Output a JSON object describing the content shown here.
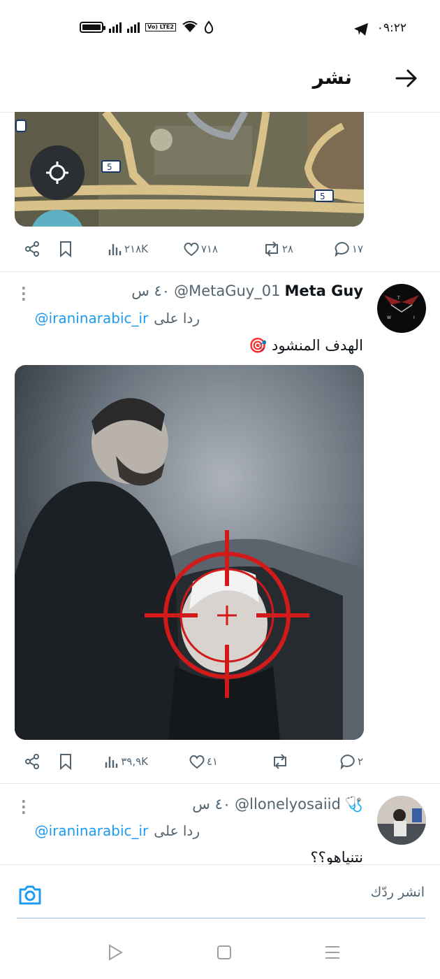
{
  "status_bar": {
    "time": "٠٩:٢٢",
    "network_label": "Vo) LTE2"
  },
  "header": {
    "title": "نشر"
  },
  "tweet1_actions": {
    "replies": "١٧",
    "retweets": "٢٨",
    "likes": "٧١٨",
    "views": "٢١٨K"
  },
  "tweet2": {
    "name": "Meta Guy",
    "handle": "@MetaGuy_01",
    "time": "٤٠ س",
    "reply_prefix": "ردا على",
    "reply_to": "@iraninarabic_ir",
    "text": "الهدف المنشود 🎯",
    "actions": {
      "replies": "٢",
      "retweets": "",
      "likes": "٤١",
      "views": "٣٩,٩K"
    }
  },
  "tweet3": {
    "name": "🩺",
    "handle": "@llonelyosaiid",
    "time": "٤٠ س",
    "reply_prefix": "ردا على",
    "reply_to": "@iraninarabic_ir",
    "text": "نتنياهو؟؟"
  },
  "compose": {
    "placeholder": "انشر ردّك"
  },
  "colors": {
    "link": "#1d9bf0",
    "muted": "#536471",
    "divider": "#e6e9ec",
    "reticle": "#d11a1a"
  }
}
